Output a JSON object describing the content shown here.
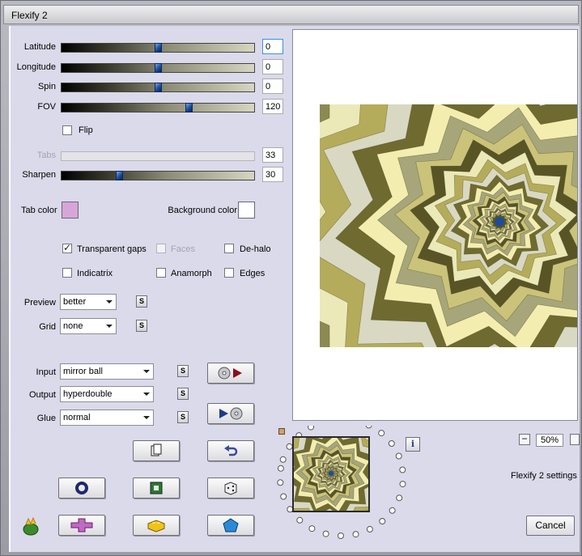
{
  "window": {
    "title": "Flexify 2"
  },
  "sliders": [
    {
      "id": "latitude",
      "label": "Latitude",
      "value": "0",
      "fraction": 0.5,
      "enabled": true,
      "focused": true
    },
    {
      "id": "longitude",
      "label": "Longitude",
      "value": "0",
      "fraction": 0.5,
      "enabled": true,
      "focused": false
    },
    {
      "id": "spin",
      "label": "Spin",
      "value": "0",
      "fraction": 0.5,
      "enabled": true,
      "focused": false
    },
    {
      "id": "fov",
      "label": "FOV",
      "value": "120",
      "fraction": 0.66,
      "enabled": true,
      "focused": false
    },
    {
      "id": "tabs",
      "label": "Tabs",
      "value": "33",
      "fraction": 0.33,
      "enabled": false,
      "focused": false
    },
    {
      "id": "sharpen",
      "label": "Sharpen",
      "value": "30",
      "fraction": 0.3,
      "enabled": true,
      "focused": false
    }
  ],
  "flip": {
    "label": "Flip",
    "checked": false
  },
  "colors": {
    "tab_label": "Tab color",
    "tab_color": "#d6a6d8",
    "background_label": "Background color",
    "background_color": "#ffffff"
  },
  "options": {
    "transparent_gaps": {
      "label": "Transparent gaps",
      "checked": true,
      "enabled": true
    },
    "faces": {
      "label": "Faces",
      "checked": false,
      "enabled": false
    },
    "de_halo": {
      "label": "De-halo",
      "checked": false,
      "enabled": true
    },
    "indicatrix": {
      "label": "Indicatrix",
      "checked": false,
      "enabled": true
    },
    "anamorph": {
      "label": "Anamorph",
      "checked": false,
      "enabled": true
    },
    "edges": {
      "label": "Edges",
      "checked": false,
      "enabled": true
    }
  },
  "preview_quality": {
    "label": "Preview",
    "value": "better"
  },
  "grid": {
    "label": "Grid",
    "value": "none"
  },
  "input": {
    "label": "Input",
    "value": "mirror ball"
  },
  "output": {
    "label": "Output",
    "value": "hyperdouble"
  },
  "glue": {
    "label": "Glue",
    "value": "normal"
  },
  "s_label": "S",
  "info_label": "i",
  "zoom": {
    "value": "50%",
    "minus": "−"
  },
  "status_text": "Flexify 2 settings",
  "cancel_label": "Cancel",
  "accent": "#1d4d9a"
}
